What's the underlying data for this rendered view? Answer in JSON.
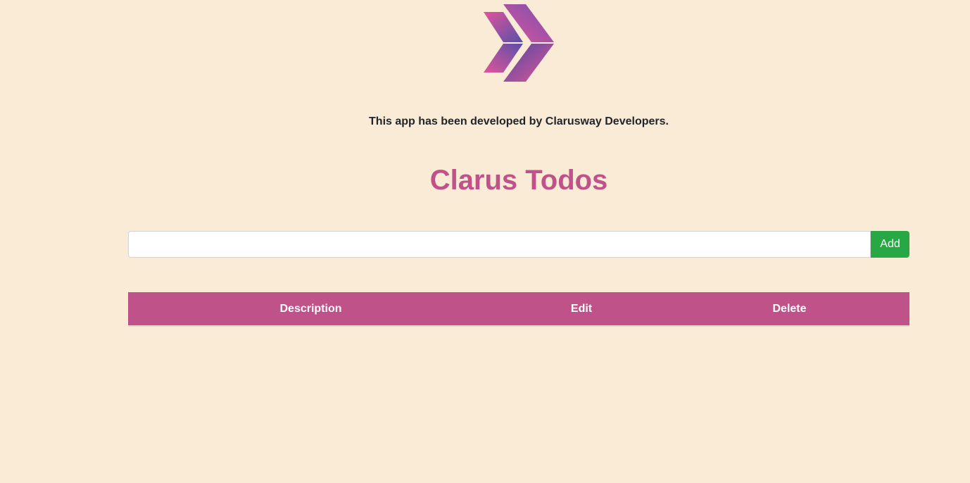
{
  "header": {
    "logo": "clarusway-chevron-logo",
    "credit_text": "This app has been developed by Clarusway Developers.",
    "title": "Clarus Todos"
  },
  "form": {
    "input_value": "",
    "input_placeholder": "",
    "add_label": "Add"
  },
  "table": {
    "columns": [
      "Description",
      "Edit",
      "Delete"
    ],
    "rows": []
  },
  "colors": {
    "background": "#faebd7",
    "accent": "#c0528a",
    "add_button": "#28a745"
  }
}
